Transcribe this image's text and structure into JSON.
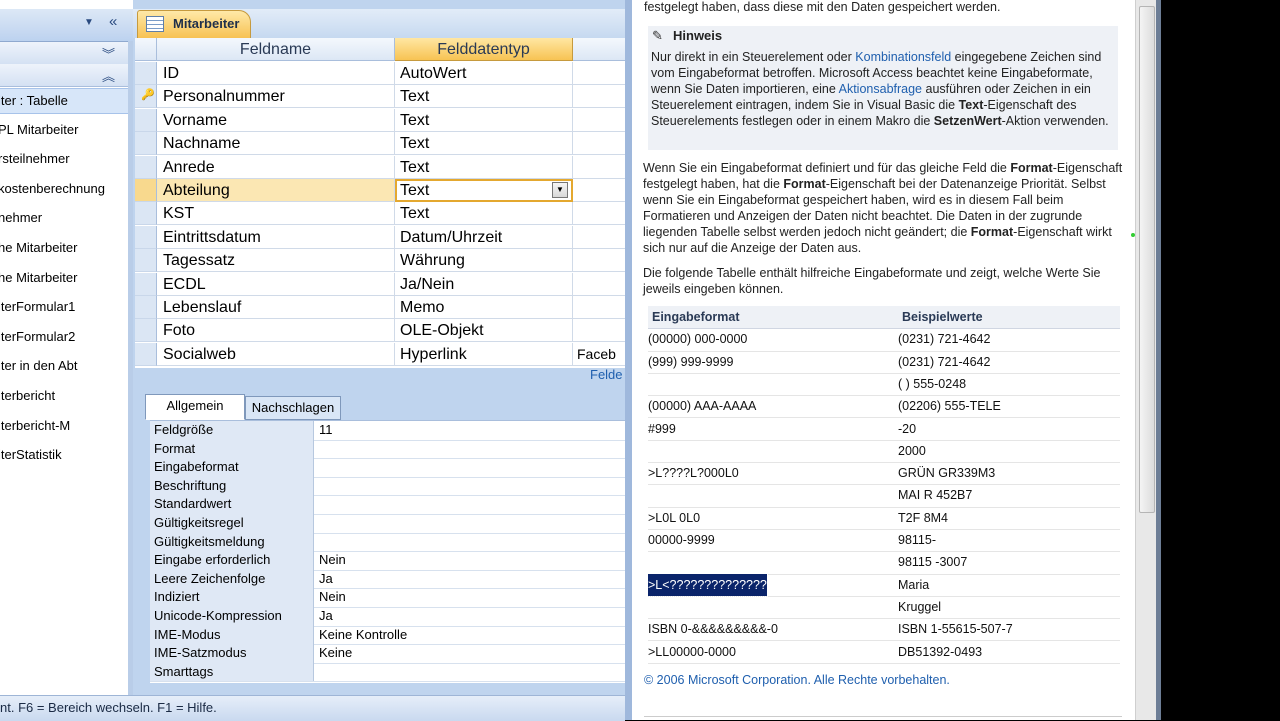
{
  "nav": {
    "items": [
      {
        "label": "iter : Tabelle",
        "selected": true
      },
      {
        "label": "PL Mitarbeiter"
      },
      {
        "label": "rsteilnehmer"
      },
      {
        "label": "kostenberechnung"
      },
      {
        "label": "nehmer"
      },
      {
        "label": "he Mitarbeiter"
      },
      {
        "label": "he Mitarbeiter"
      },
      {
        "label": "iterFormular1"
      },
      {
        "label": "iterFormular2"
      },
      {
        "label": "iter in den Abt"
      },
      {
        "label": "iterbericht"
      },
      {
        "label": "iterbericht-M"
      },
      {
        "label": "iterStatistik"
      }
    ]
  },
  "design": {
    "tab_title": "Mitarbeiter",
    "col_name": "Feldname",
    "col_type": "Felddatentyp",
    "rows": [
      {
        "name": "ID",
        "type": "AutoWert",
        "desc": ""
      },
      {
        "name": "Personalnummer",
        "type": "Text",
        "desc": "",
        "key": true
      },
      {
        "name": "Vorname",
        "type": "Text",
        "desc": ""
      },
      {
        "name": "Nachname",
        "type": "Text",
        "desc": ""
      },
      {
        "name": "Anrede",
        "type": "Text",
        "desc": ""
      },
      {
        "name": "Abteilung",
        "type": "Text",
        "desc": "",
        "current": true
      },
      {
        "name": "KST",
        "type": "Text",
        "desc": ""
      },
      {
        "name": "Eintrittsdatum",
        "type": "Datum/Uhrzeit",
        "desc": ""
      },
      {
        "name": "Tagessatz",
        "type": "Währung",
        "desc": ""
      },
      {
        "name": "ECDL",
        "type": "Ja/Nein",
        "desc": ""
      },
      {
        "name": "Lebenslauf",
        "type": "Memo",
        "desc": ""
      },
      {
        "name": "Foto",
        "type": "OLE-Objekt",
        "desc": ""
      },
      {
        "name": "Socialweb",
        "type": "Hyperlink",
        "desc": "Faceb"
      }
    ],
    "felde": "Felde",
    "tab_general": "Allgemein",
    "tab_lookup": "Nachschlagen",
    "properties": [
      {
        "label": "Feldgröße",
        "value": "11"
      },
      {
        "label": "Format",
        "value": ""
      },
      {
        "label": "Eingabeformat",
        "value": ""
      },
      {
        "label": "Beschriftung",
        "value": ""
      },
      {
        "label": "Standardwert",
        "value": ""
      },
      {
        "label": "Gültigkeitsregel",
        "value": ""
      },
      {
        "label": "Gültigkeitsmeldung",
        "value": ""
      },
      {
        "label": "Eingabe erforderlich",
        "value": "Nein"
      },
      {
        "label": "Leere Zeichenfolge",
        "value": "Ja"
      },
      {
        "label": "Indiziert",
        "value": "Nein"
      },
      {
        "label": "Unicode-Kompression",
        "value": "Ja"
      },
      {
        "label": "IME-Modus",
        "value": "Keine Kontrolle"
      },
      {
        "label": "IME-Satzmodus",
        "value": "Keine"
      },
      {
        "label": "Smarttags",
        "value": ""
      }
    ],
    "status": "nt. F6 = Bereich wechseln. F1 = Hilfe."
  },
  "help": {
    "top_line": "festgelegt haben, dass diese mit den Daten gespeichert werden.",
    "hinweis_title": "Hinweis",
    "hinweis": {
      "p1": "Nur direkt in ein Steuerelement oder ",
      "link1": "Kombinationsfeld",
      "p2": " eingegebene Zeichen sind vom Eingabeformat betroffen. Microsoft Access beachtet keine Eingabeformate, wenn Sie Daten importieren, eine ",
      "link2": "Aktionsabfrage",
      "p3": " ausführen oder Zeichen in ein Steuerelement eintragen, indem Sie in Visual Basic die ",
      "b1": "Text",
      "p4": "-Eigenschaft des Steuerelements festlegen oder in einem Makro die ",
      "b2": "SetzenWert",
      "p5": "-Aktion verwenden."
    },
    "para2": {
      "p1": "Wenn Sie ein Eingabeformat definiert und für das gleiche Feld die ",
      "b1": "Format",
      "p2": "-Eigenschaft festgelegt haben, hat die ",
      "b2": "Format",
      "p3": "-Eigenschaft bei der Datenanzeige Priorität. Selbst wenn Sie ein Eingabeformat gespeichert haben, wird es in diesem Fall beim Formatieren und Anzeigen der Daten nicht beachtet. Die Daten in der zugrunde liegenden Tabelle selbst werden jedoch nicht geändert; die ",
      "b3": "Format",
      "p4": "-Eigenschaft wirkt sich nur auf die Anzeige der Daten aus."
    },
    "para3": "Die folgende Tabelle enthält hilfreiche Eingabeformate und zeigt, welche Werte Sie jeweils eingeben können.",
    "table_head": [
      "Eingabeformat",
      "Beispielwerte"
    ],
    "table": [
      [
        "(00000) 000-0000",
        "(0231) 721-4642"
      ],
      [
        "(999) 999-9999",
        "(0231) 721-4642"
      ],
      [
        "",
        "(   ) 555-0248"
      ],
      [
        "(00000) AAA-AAAA",
        "(02206) 555-TELE"
      ],
      [
        "#999",
        "-20"
      ],
      [
        "",
        "2000"
      ],
      [
        ">L????L?000L0",
        "GRÜN GR339M3"
      ],
      [
        "",
        "MAI R 452B7"
      ],
      [
        ">L0L 0L0",
        "T2F 8M4"
      ],
      [
        "00000-9999",
        "98115-"
      ],
      [
        "",
        "98115 -3007"
      ],
      [
        ">L<??????????????",
        "Maria"
      ],
      [
        "",
        "Kruggel"
      ],
      [
        "ISBN 0-&&&&&&&&&-0",
        "ISBN 1-55615-507-7"
      ],
      [
        ">LL00000-0000",
        "DB51392-0493"
      ]
    ],
    "copyright": "© 2006 Microsoft Corporation. Alle Rechte vorbehalten."
  },
  "colors": {
    "accent": "#f7c353",
    "link": "#1f5fae",
    "nav_bg": "#bfd4ee"
  }
}
